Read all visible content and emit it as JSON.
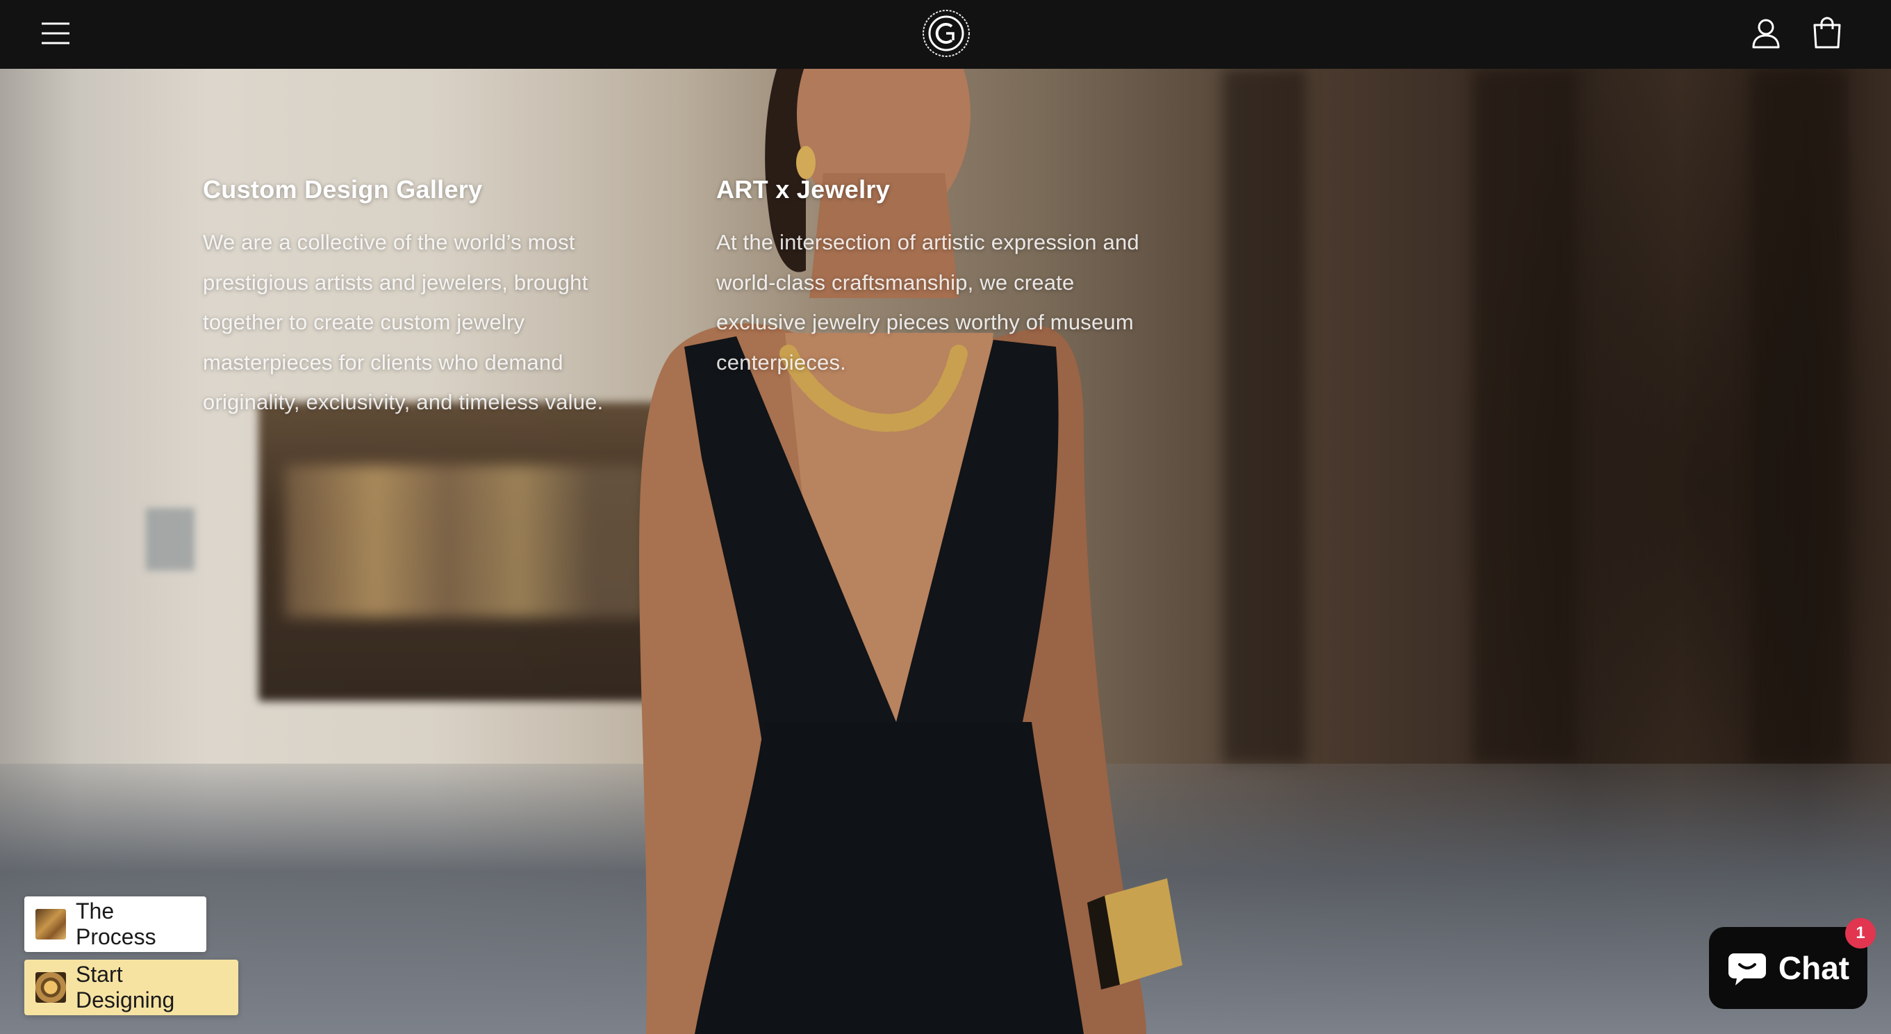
{
  "header": {
    "menu_icon": "hamburger-menu-icon",
    "logo_icon": "custom-design-gallery-logo",
    "account_icon": "user-account-icon",
    "cart_icon": "shopping-bag-icon",
    "background": "#121212"
  },
  "columns": [
    {
      "title": "Custom Design Gallery",
      "lines": [
        "We are a collective of the world’s most",
        "prestigious artists and jewelers, brought",
        "together to create custom jewelry",
        "masterpieces for clients who demand",
        "originality, exclusivity, and timeless value."
      ]
    },
    {
      "title": "ART x Jewelry",
      "lines": [
        "At the intersection of artistic expression and",
        "world-class craftsmanship, we create",
        "exclusive jewelry pieces worthy of museum",
        "centerpieces."
      ]
    }
  ],
  "buttons": {
    "process_label": "The Process",
    "design_label": "Start Designing"
  },
  "chat": {
    "label": "Chat",
    "badge_count": "1",
    "icon": "chat-bubble-icon"
  },
  "colors": {
    "design_button": "#f6e3a2",
    "chat_badge": "#e2354f",
    "chat_bg": "#0b0b0b"
  }
}
